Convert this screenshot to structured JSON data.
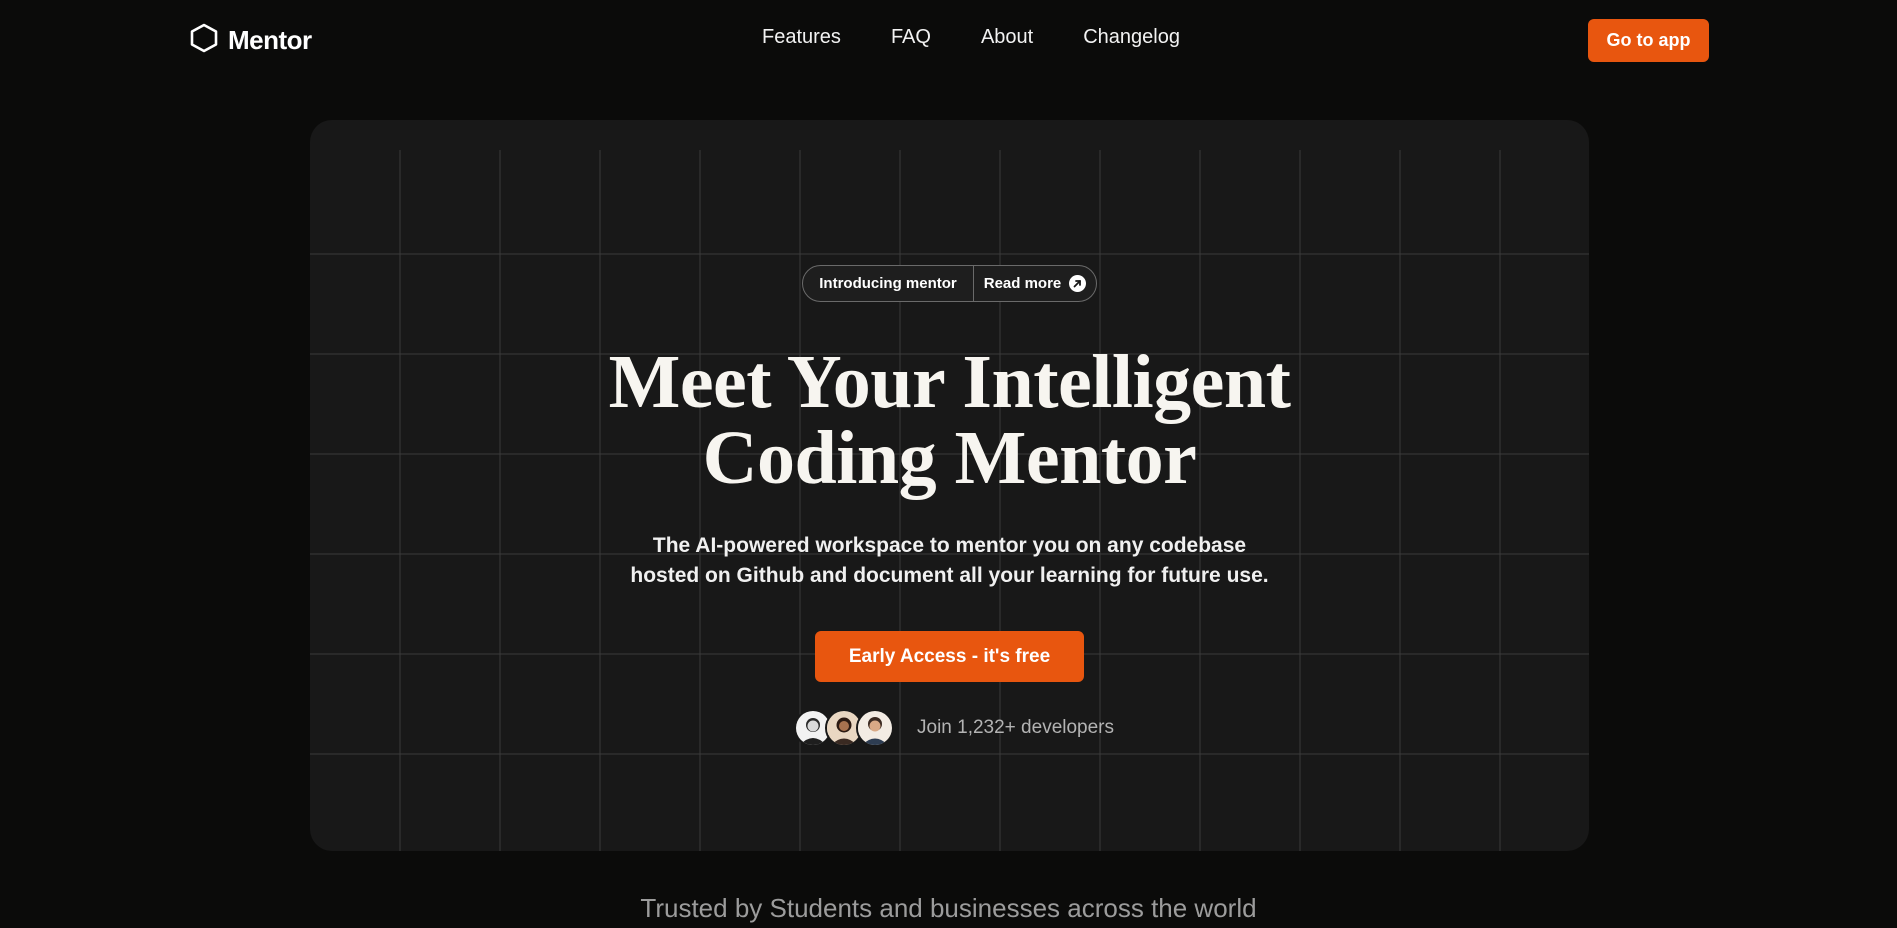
{
  "nav": {
    "logo_text": "Mentor",
    "logo_icon": "hexagon-icon",
    "links": [
      "Features",
      "FAQ",
      "About",
      "Changelog"
    ],
    "cta_label": "Go to app"
  },
  "hero": {
    "badge": {
      "left_label": "Introducing mentor",
      "right_label": "Read more",
      "right_icon": "arrow-up-right-icon"
    },
    "headline_line1": "Meet Your Intelligent",
    "headline_line2": "Coding Mentor",
    "subtitle_line1": "The AI-powered workspace to mentor you on any codebase",
    "subtitle_line2": "hosted on Github and document all your learning for future use.",
    "cta_label": "Early Access - it's free",
    "social_proof": "Join 1,232+ developers"
  },
  "trusted_text": "Trusted by Students and businesses across the world",
  "colors": {
    "accent": "#e8560f",
    "background": "#0b0b0a",
    "card": "#181818"
  }
}
